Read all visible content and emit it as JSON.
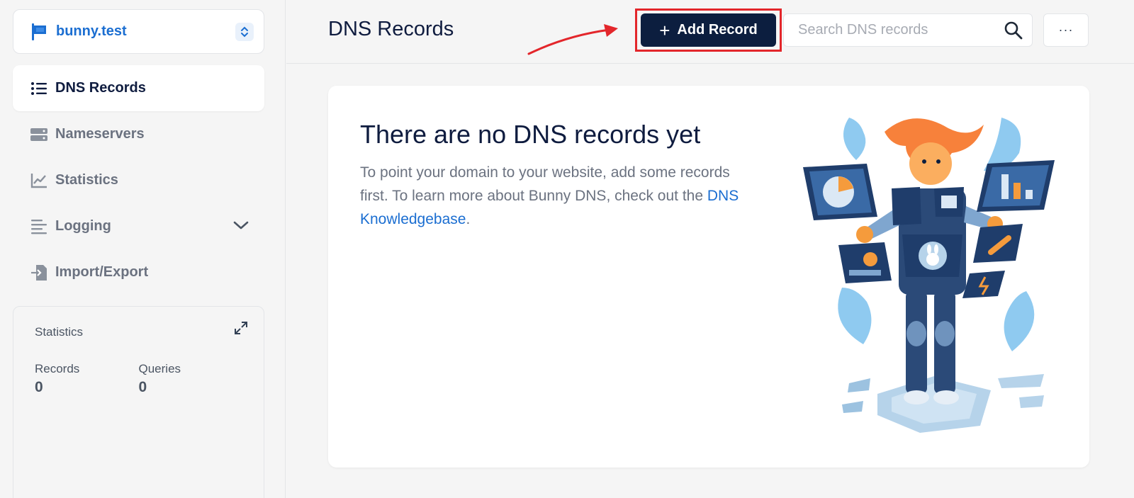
{
  "sidebar": {
    "zone_name": "bunny.test",
    "nav": [
      {
        "label": "DNS Records",
        "icon": "list-icon",
        "active": true
      },
      {
        "label": "Nameservers",
        "icon": "server-icon"
      },
      {
        "label": "Statistics",
        "icon": "chart-line-icon"
      },
      {
        "label": "Logging",
        "icon": "logging-icon",
        "expandable": true
      },
      {
        "label": "Import/Export",
        "icon": "file-import-icon"
      }
    ],
    "stats": {
      "title": "Statistics",
      "records_label": "Records",
      "records_value": "0",
      "queries_label": "Queries",
      "queries_value": "0"
    }
  },
  "header": {
    "title": "DNS Records",
    "add_label": "Add Record",
    "search_placeholder": "Search DNS records",
    "more_label": "···"
  },
  "empty": {
    "title": "There are no DNS records yet",
    "desc_text": "To point your domain to your website, add some records first. To learn more about Bunny DNS, check out the ",
    "link_text": "DNS Knowledgebase",
    "desc_end": "."
  },
  "colors": {
    "brand_dark": "#0c1e3f",
    "link_blue": "#1b6ed1",
    "annotation_red": "#e3262b"
  }
}
